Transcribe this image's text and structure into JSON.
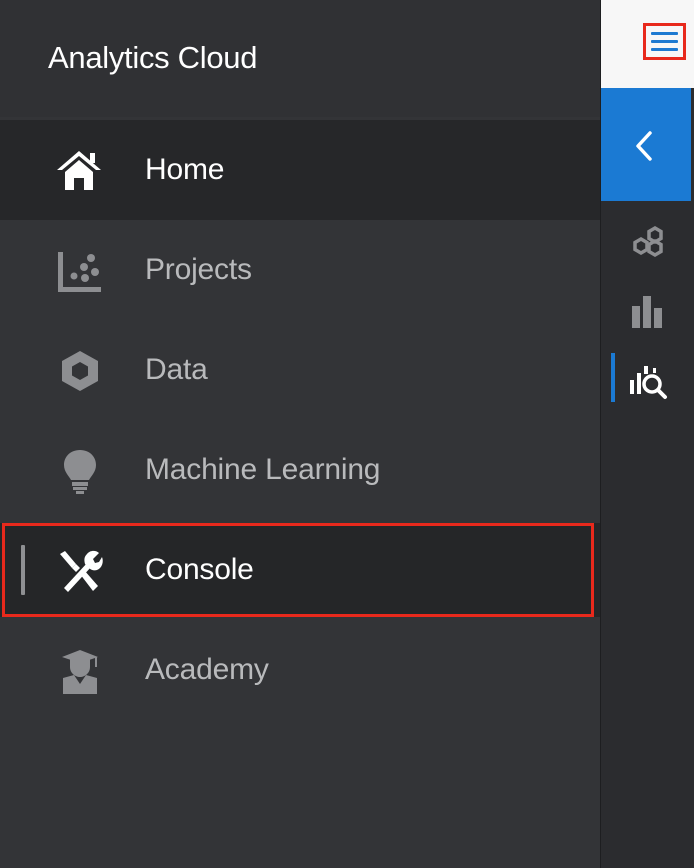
{
  "app": {
    "title": "Analytics Cloud"
  },
  "nav": {
    "items": [
      {
        "label": "Home",
        "icon": "home-icon",
        "state": "active"
      },
      {
        "label": "Projects",
        "icon": "projects-icon",
        "state": "normal"
      },
      {
        "label": "Data",
        "icon": "data-icon",
        "state": "normal"
      },
      {
        "label": "Machine Learning",
        "icon": "lightbulb-icon",
        "state": "normal"
      },
      {
        "label": "Console",
        "icon": "tools-icon",
        "state": "highlighted"
      },
      {
        "label": "Academy",
        "icon": "academy-icon",
        "state": "normal"
      }
    ]
  },
  "rail": {
    "icons": [
      "menu-icon",
      "collapse-chevron-icon",
      "hexagons-icon",
      "bar-chart-icon",
      "search-analytics-icon"
    ],
    "active_icon": "search-analytics-icon"
  },
  "colors": {
    "accent_blue": "#1b7ad3",
    "highlight_red": "#e8291c",
    "drawer_bg": "#333437",
    "active_item_bg": "#262729"
  }
}
